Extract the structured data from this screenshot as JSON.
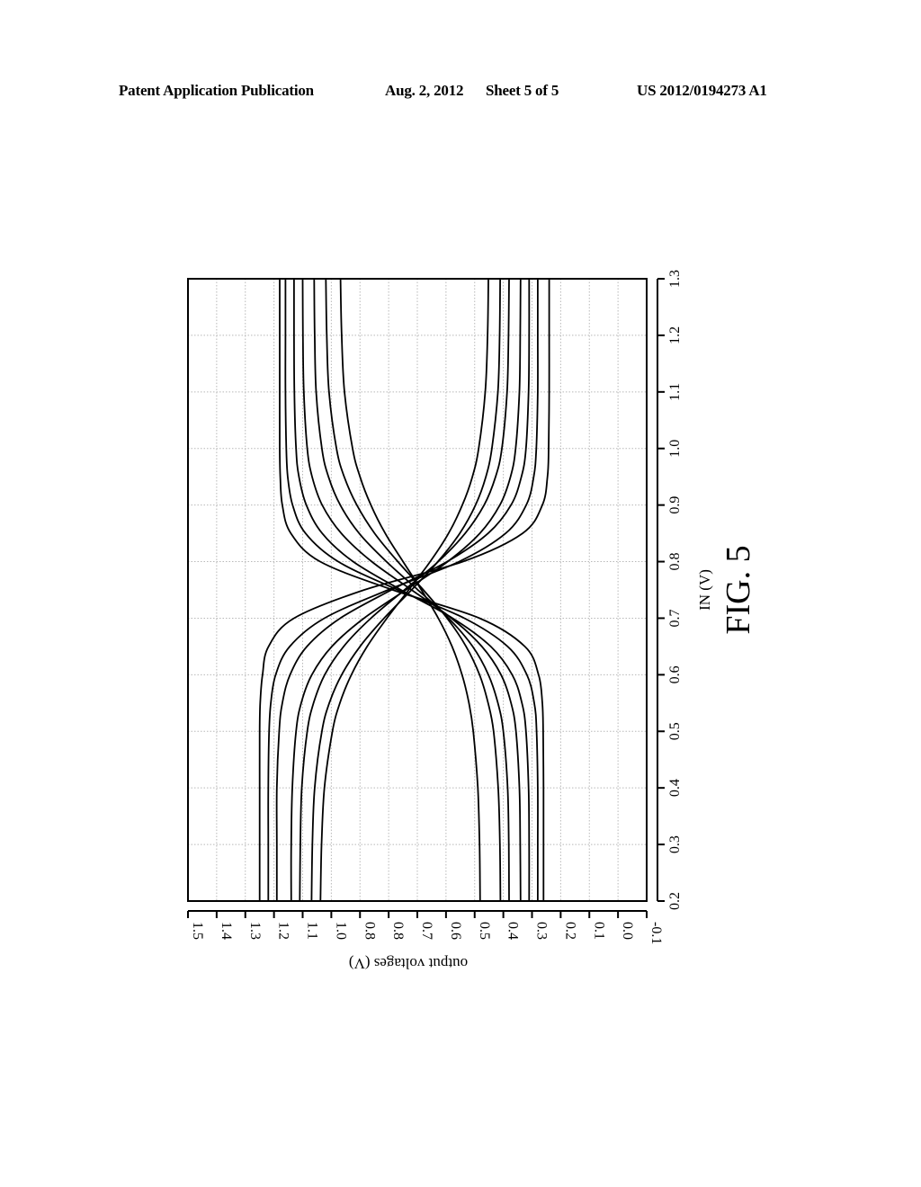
{
  "header": {
    "publication": "Patent Application Publication",
    "date": "Aug. 2, 2012",
    "sheet": "Sheet 5 of 5",
    "number": "US 2012/0194273 A1"
  },
  "figure_label": "FIG. 5",
  "chart_data": {
    "type": "line",
    "orientation": "rotated 90 degrees on page (IN axis vertical, output voltage axis horizontal)",
    "title": "",
    "xlabel": "IN (V)",
    "ylabel": "output voltages (V)",
    "xlim": [
      0.2,
      1.3
    ],
    "ylim": [
      -0.1,
      1.5
    ],
    "x_ticks": [
      "0.2",
      "0.3",
      "0.4",
      "0.5",
      "0.6",
      "0.7",
      "0.8",
      "0.9",
      "1.0",
      "1.1",
      "1.2",
      "1.3"
    ],
    "y_ticks": [
      "1.5",
      "1.4",
      "1.3",
      "1.2",
      "1.1",
      "1.0",
      "0.8",
      "0.8",
      "0.7",
      "0.6",
      "0.5",
      "0.4",
      "0.3",
      "0.2",
      "0.1",
      "0.0",
      "-0.1"
    ],
    "y_tick_values": [
      1.5,
      1.4,
      1.3,
      1.2,
      1.1,
      1.0,
      0.9,
      0.8,
      0.7,
      0.6,
      0.5,
      0.4,
      0.3,
      0.2,
      0.1,
      0.0,
      -0.1
    ],
    "grid": true,
    "legend": "none",
    "line_color": "#000000",
    "grid_color": "#b8b8b8",
    "x": [
      0.2,
      0.3,
      0.4,
      0.5,
      0.55,
      0.6,
      0.65,
      0.7,
      0.75,
      0.8,
      0.85,
      0.9,
      0.95,
      1.0,
      1.1,
      1.2,
      1.3
    ],
    "series": [
      {
        "name": "falling-1",
        "values": [
          1.25,
          1.25,
          1.25,
          1.25,
          1.248,
          1.24,
          1.219,
          1.13,
          0.885,
          0.541,
          0.333,
          0.264,
          0.246,
          0.242,
          0.24,
          0.24,
          0.24
        ]
      },
      {
        "name": "falling-2",
        "values": [
          1.22,
          1.22,
          1.22,
          1.217,
          1.211,
          1.194,
          1.145,
          1.024,
          0.802,
          0.554,
          0.392,
          0.32,
          0.294,
          0.285,
          0.28,
          0.28,
          0.28
        ]
      },
      {
        "name": "falling-3",
        "values": [
          1.19,
          1.19,
          1.19,
          1.182,
          1.171,
          1.144,
          1.085,
          0.969,
          0.79,
          0.596,
          0.453,
          0.373,
          0.337,
          0.321,
          0.312,
          0.31,
          0.31
        ]
      },
      {
        "name": "falling-4",
        "values": [
          1.14,
          1.14,
          1.136,
          1.123,
          1.105,
          1.068,
          0.998,
          0.886,
          0.74,
          0.594,
          0.482,
          0.412,
          0.375,
          0.357,
          0.344,
          0.341,
          0.34
        ]
      },
      {
        "name": "falling-5",
        "values": [
          1.11,
          1.108,
          1.103,
          1.084,
          1.062,
          1.023,
          0.957,
          0.862,
          0.745,
          0.627,
          0.533,
          0.467,
          0.427,
          0.405,
          0.387,
          0.382,
          0.38
        ]
      },
      {
        "name": "falling-6",
        "values": [
          1.069,
          1.066,
          1.058,
          1.033,
          1.007,
          0.964,
          0.9,
          0.816,
          0.72,
          0.628,
          0.552,
          0.497,
          0.461,
          0.44,
          0.419,
          0.413,
          0.411
        ]
      },
      {
        "name": "falling-7",
        "values": [
          1.038,
          1.034,
          1.024,
          0.996,
          0.97,
          0.93,
          0.875,
          0.806,
          0.73,
          0.655,
          0.591,
          0.543,
          0.508,
          0.486,
          0.463,
          0.455,
          0.452
        ]
      },
      {
        "name": "rising-1",
        "values": [
          0.26,
          0.26,
          0.26,
          0.261,
          0.264,
          0.277,
          0.325,
          0.483,
          0.786,
          1.039,
          1.141,
          1.171,
          1.178,
          1.18,
          1.18,
          1.18,
          1.18
        ]
      },
      {
        "name": "rising-2",
        "values": [
          0.28,
          0.28,
          0.28,
          0.284,
          0.292,
          0.318,
          0.385,
          0.536,
          0.768,
          0.976,
          1.09,
          1.135,
          1.152,
          1.157,
          1.16,
          1.16,
          1.16
        ]
      },
      {
        "name": "rising-3",
        "values": [
          0.31,
          0.31,
          0.312,
          0.321,
          0.335,
          0.369,
          0.444,
          0.577,
          0.757,
          0.924,
          1.032,
          1.087,
          1.113,
          1.123,
          1.129,
          1.13,
          1.13
        ]
      },
      {
        "name": "rising-4",
        "values": [
          0.34,
          0.341,
          0.344,
          0.356,
          0.373,
          0.408,
          0.475,
          0.581,
          0.72,
          0.859,
          0.965,
          1.032,
          1.067,
          1.084,
          1.096,
          1.099,
          1.1
        ]
      },
      {
        "name": "rising-5",
        "values": [
          0.38,
          0.381,
          0.385,
          0.4,
          0.419,
          0.452,
          0.507,
          0.591,
          0.698,
          0.808,
          0.903,
          0.969,
          1.01,
          1.033,
          1.053,
          1.058,
          1.06
        ]
      },
      {
        "name": "rising-6",
        "values": [
          0.41,
          0.412,
          0.418,
          0.434,
          0.453,
          0.483,
          0.53,
          0.596,
          0.679,
          0.768,
          0.849,
          0.911,
          0.955,
          0.982,
          1.008,
          1.016,
          1.019
        ]
      },
      {
        "name": "rising-7",
        "values": [
          0.481,
          0.483,
          0.489,
          0.505,
          0.52,
          0.544,
          0.579,
          0.627,
          0.686,
          0.75,
          0.812,
          0.862,
          0.9,
          0.926,
          0.954,
          0.964,
          0.968
        ]
      }
    ]
  }
}
